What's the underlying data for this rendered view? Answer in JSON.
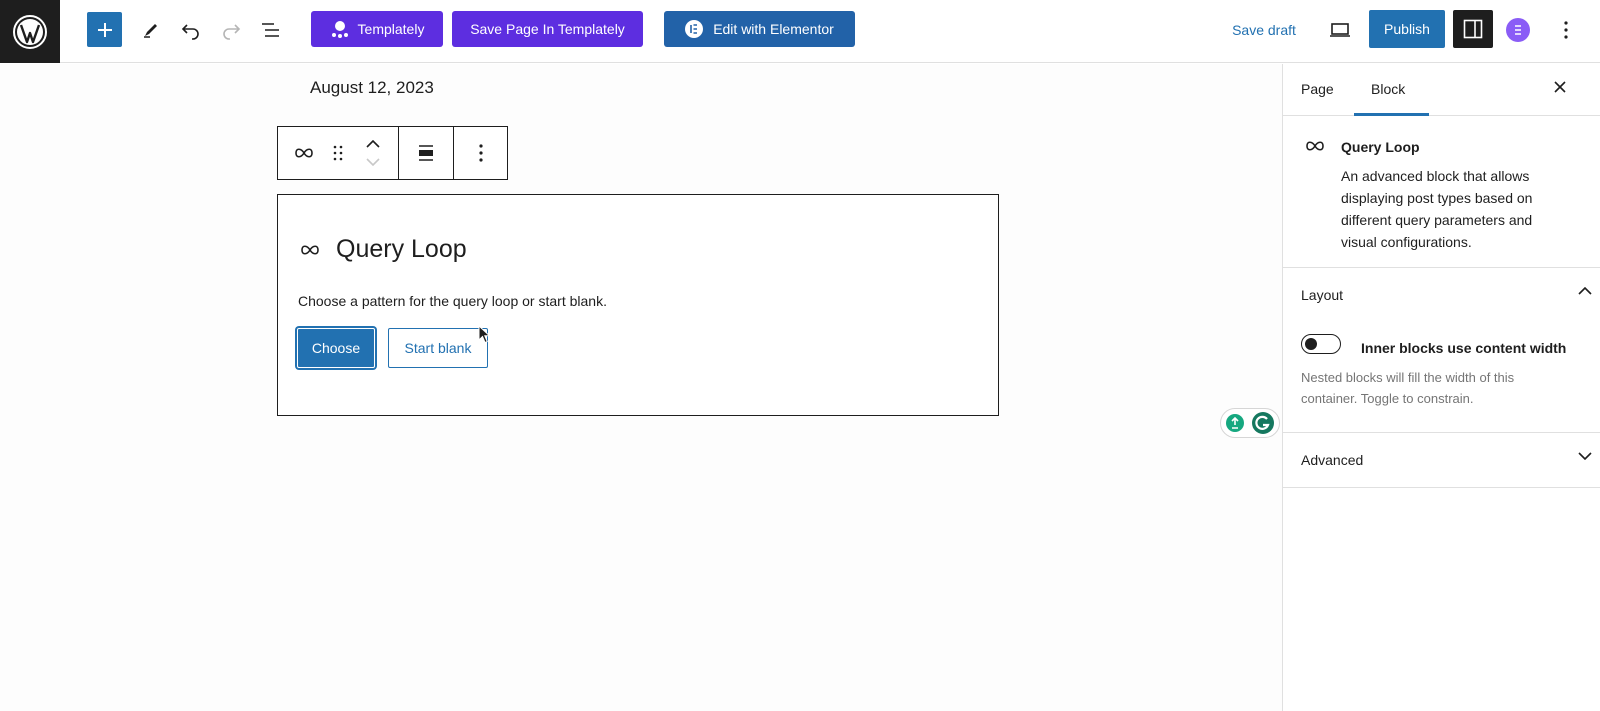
{
  "topbar": {
    "templately_label": "Templately",
    "save_templately_label": "Save Page In Templately",
    "elementor_label": "Edit with Elementor",
    "save_draft_label": "Save draft",
    "publish_label": "Publish"
  },
  "canvas": {
    "date": "August 12, 2023",
    "query_loop": {
      "title": "Query Loop",
      "description": "Choose a pattern for the query loop or start blank.",
      "choose_label": "Choose",
      "start_blank_label": "Start blank"
    }
  },
  "sidebar": {
    "tabs": {
      "page": "Page",
      "block": "Block"
    },
    "block_card": {
      "title": "Query Loop",
      "description": "An advanced block that allows displaying post types based on different query parameters and visual configurations."
    },
    "layout": {
      "title": "Layout",
      "toggle_label": "Inner blocks use content width",
      "toggle_help": "Nested blocks will fill the width of this container. Toggle to constrain.",
      "toggle_on": false
    },
    "advanced": {
      "title": "Advanced"
    }
  },
  "colors": {
    "wp_blue": "#2271b1",
    "templately_purple": "#5d2ee0",
    "elementor_blue": "#2262a8",
    "dark": "#1e1e1e"
  }
}
